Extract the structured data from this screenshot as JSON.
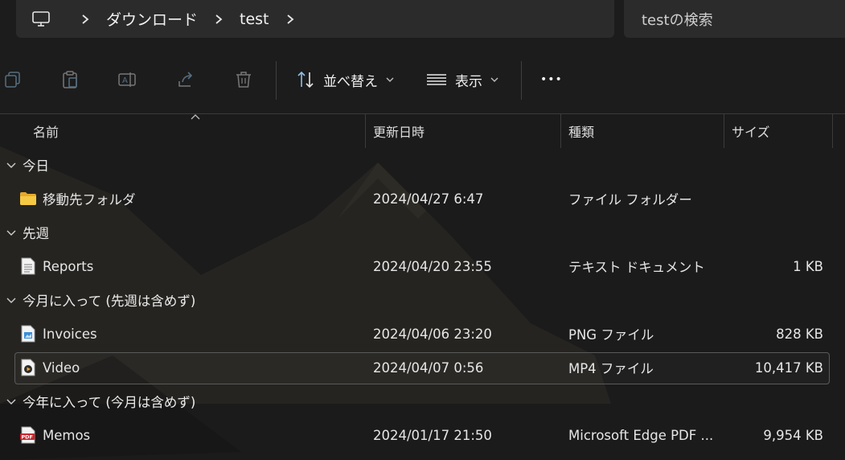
{
  "address_bar": {
    "breadcrumbs": [
      "ダウンロード",
      "test"
    ],
    "search_placeholder": "testの検索"
  },
  "command_bar": {
    "sort_label": "並べ替え",
    "view_label": "表示",
    "more_label": "•••"
  },
  "columns": {
    "name": "名前",
    "modified": "更新日時",
    "type": "種類",
    "size": "サイズ"
  },
  "groups": [
    {
      "label": "今日",
      "files": [
        {
          "icon": "folder-icon",
          "name": "移動先フォルダ",
          "modified": "2024/04/27 6:47",
          "type": "ファイル フォルダー",
          "size": ""
        }
      ]
    },
    {
      "label": "先週",
      "files": [
        {
          "icon": "text-document-icon",
          "name": "Reports",
          "modified": "2024/04/20 23:55",
          "type": "テキスト ドキュメント",
          "size": "1 KB"
        }
      ]
    },
    {
      "label": "今月に入って (先週は含めず)",
      "files": [
        {
          "icon": "png-image-icon",
          "name": "Invoices",
          "modified": "2024/04/06 23:20",
          "type": "PNG ファイル",
          "size": "828 KB"
        },
        {
          "icon": "video-file-icon",
          "name": "Video",
          "modified": "2024/04/07 0:56",
          "type": "MP4 ファイル",
          "size": "10,417 KB",
          "selected": true
        }
      ]
    },
    {
      "label": "今年に入って (今月は含めず)",
      "files": [
        {
          "icon": "pdf-file-icon",
          "name": "Memos",
          "modified": "2024/01/17 21:50",
          "type": "Microsoft Edge PDF ...",
          "size": "9,954 KB"
        }
      ]
    }
  ],
  "colors": {
    "background": "#1b1b1b",
    "address_box": "#2b2b2b",
    "accent_blue": "#4aa3e8",
    "folder_yellow": "#f3c340",
    "pdf_red": "#c8262c"
  }
}
